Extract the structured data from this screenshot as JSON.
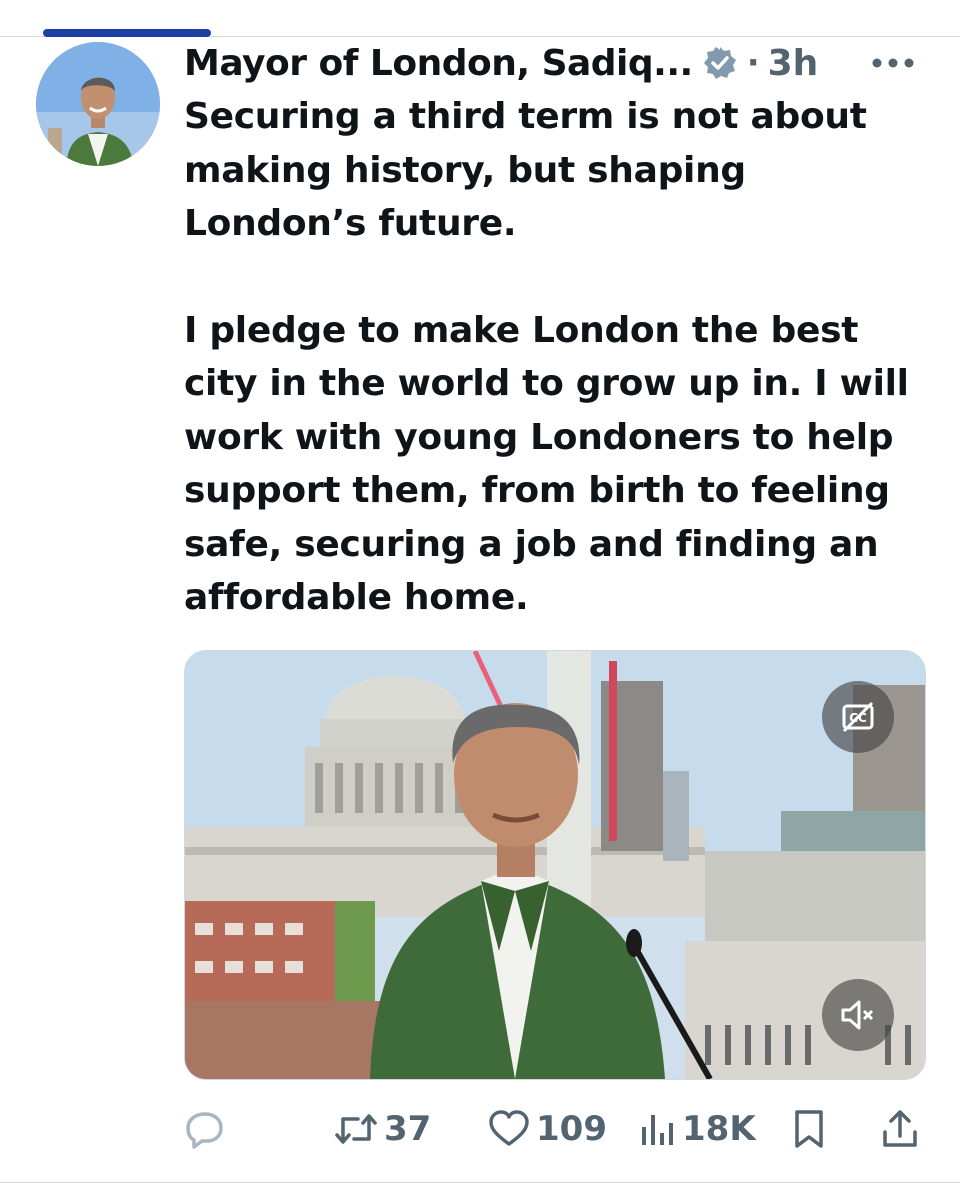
{
  "post": {
    "author_name": "Mayor of London, Sadiq...",
    "separator": "·",
    "time": "3h",
    "paragraphs": [
      "Securing a third term is not about\nmaking history, but shaping\nLondon’s future.",
      "I pledge to make London the best\ncity in the world to grow up in. I will\nwork with young Londoners to help\nsupport them, from birth to feeling\nsafe, securing a job and finding an\naffordable home."
    ]
  },
  "icons": {
    "verified": "verified-badge-icon",
    "more": "more-options-icon",
    "captions": "captions-off-icon",
    "mute": "muted-speaker-icon",
    "reply": "reply-icon",
    "repost": "repost-icon",
    "like": "heart-icon",
    "views": "views-chart-icon",
    "bookmark": "bookmark-icon",
    "share": "share-icon"
  },
  "actions": {
    "reposts": "37",
    "likes": "109",
    "views": "18K"
  },
  "colors": {
    "tab_indicator": "#1d3fa6",
    "text_primary": "#0f1419",
    "text_secondary": "#536471",
    "verified_badge": "#829aab"
  }
}
